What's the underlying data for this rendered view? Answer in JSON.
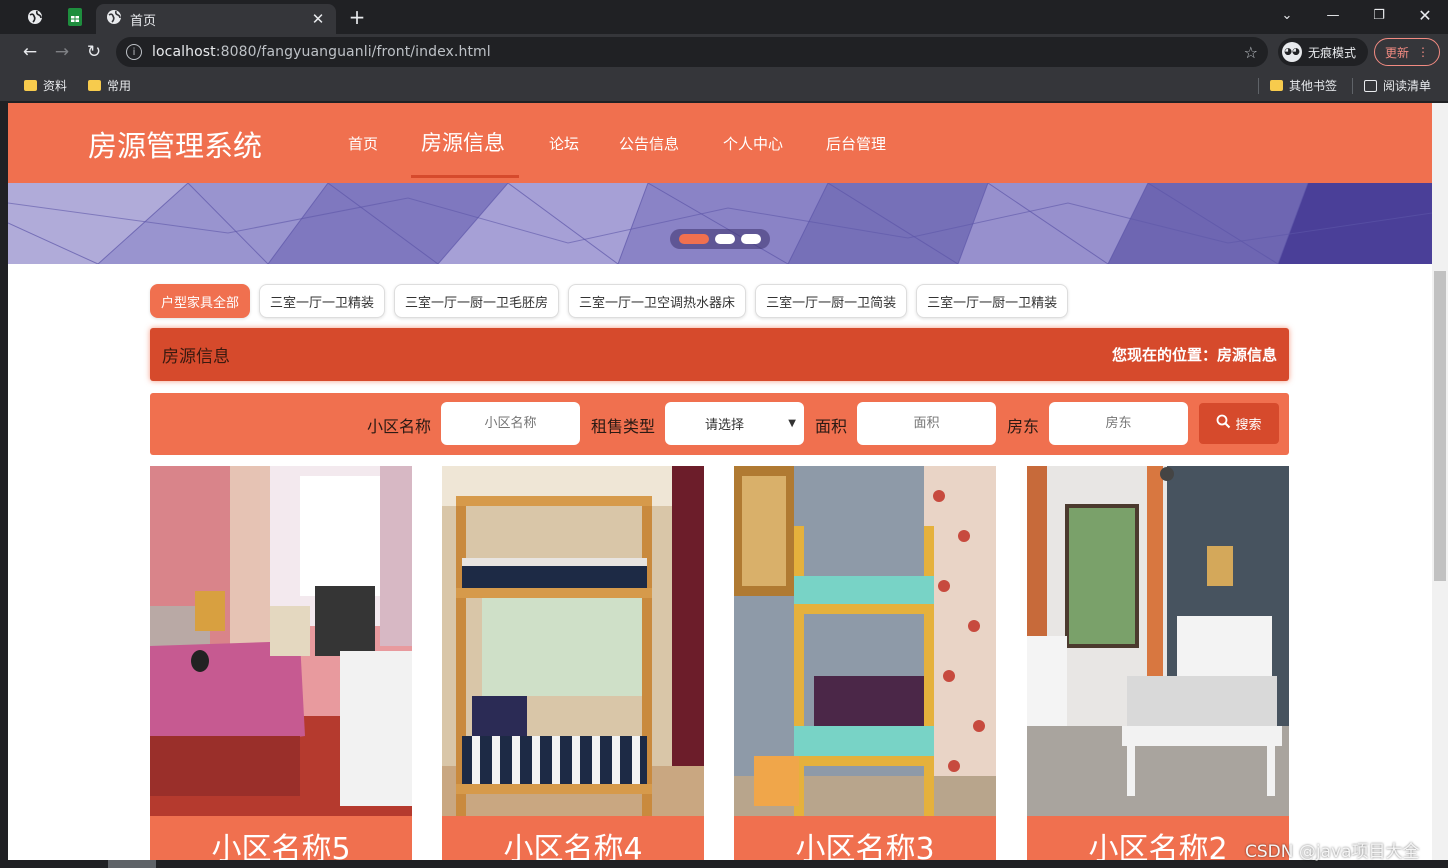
{
  "browser": {
    "tab_title": "首页",
    "url_host": "localhost",
    "url_rest": ":8080/fangyuanguanli/front/index.html",
    "incognito_label": "无痕模式",
    "update_label": "更新",
    "bookmarks": [
      "资料",
      "常用"
    ],
    "bookmarks_right": [
      "其他书签",
      "阅读清单"
    ]
  },
  "site": {
    "title": "房源管理系统",
    "nav": [
      "首页",
      "房源信息",
      "论坛",
      "公告信息",
      "个人中心",
      "后台管理"
    ],
    "active_nav_index": 1
  },
  "tags": [
    "户型家具全部",
    "三室一厅一卫精装",
    "三室一厅一厨一卫毛胚房",
    "三室一厅一卫空调热水器床",
    "三室一厅一厨一卫简装",
    "三室一厅一厨一卫精装"
  ],
  "section": {
    "title": "房源信息",
    "breadcrumb": "您现在的位置：房源信息"
  },
  "search": {
    "community_label": "小区名称",
    "community_placeholder": "小区名称",
    "type_label": "租售类型",
    "type_selected": "请选择",
    "area_label": "面积",
    "area_placeholder": "面积",
    "landlord_label": "房东",
    "landlord_placeholder": "房东",
    "button_label": "搜索"
  },
  "cards": [
    "小区名称5",
    "小区名称4",
    "小区名称3",
    "小区名称2"
  ],
  "watermark": "CSDN @java项目大全",
  "colors": {
    "primary": "#f0704f",
    "dark": "#d64a2c"
  }
}
